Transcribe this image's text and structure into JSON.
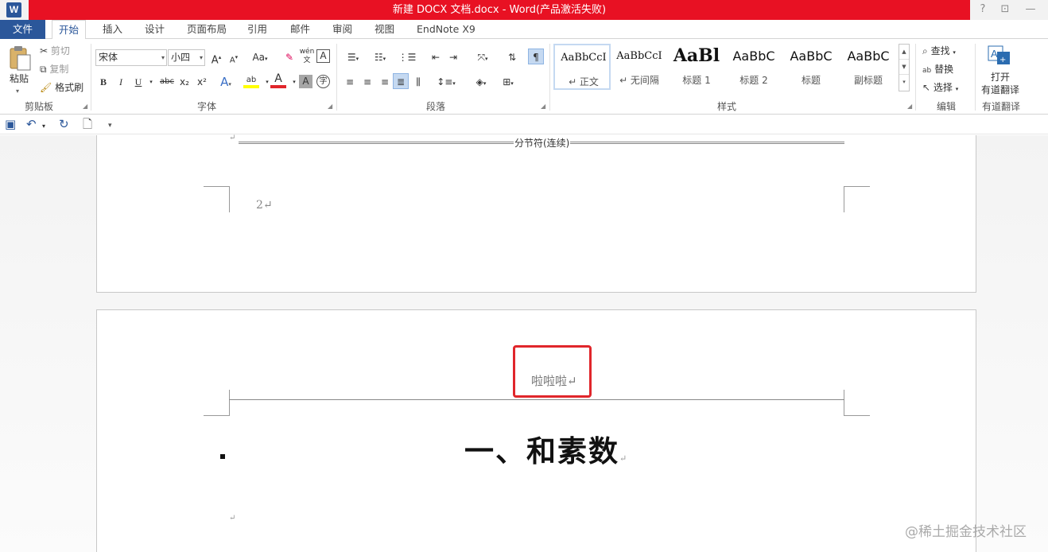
{
  "titlebar": {
    "app_icon": "W",
    "title": "新建 DOCX 文档.docx - Word(产品激活失败)",
    "help": "?",
    "restore": "⊡",
    "minimize": "—"
  },
  "tabs": {
    "file": "文件",
    "home": "开始",
    "insert": "插入",
    "design": "设计",
    "layout": "页面布局",
    "references": "引用",
    "mailings": "邮件",
    "review": "审阅",
    "view": "视图",
    "endnote": "EndNote X9"
  },
  "clipboard": {
    "paste": "粘贴",
    "cut": "剪切",
    "copy": "复制",
    "format_painter": "格式刷",
    "label": "剪贴板"
  },
  "font": {
    "name": "宋体",
    "size": "小四",
    "grow": "A",
    "shrink": "A",
    "case": "Aa",
    "bold": "B",
    "italic": "I",
    "underline": "U",
    "strike": "abc",
    "subscript": "x₂",
    "superscript": "x²",
    "effects": "A",
    "highlight": "ab",
    "color": "A",
    "shade": "A",
    "enclose": "字",
    "phonetic": "wén",
    "border": "A",
    "label": "字体"
  },
  "paragraph": {
    "label": "段落"
  },
  "styles": {
    "items": [
      {
        "sample": "AaBbCcI",
        "name": "↵ 正文"
      },
      {
        "sample": "AaBbCcI",
        "name": "↵ 无间隔"
      },
      {
        "sample": "AaBl",
        "name": "标题 1"
      },
      {
        "sample": "AaBbC",
        "name": "标题 2"
      },
      {
        "sample": "AaBbC",
        "name": "标题"
      },
      {
        "sample": "AaBbC",
        "name": "副标题"
      }
    ],
    "label": "样式"
  },
  "editing": {
    "find": "查找",
    "replace": "替换",
    "select": "选择",
    "label": "编辑"
  },
  "youdao": {
    "open_line1": "打开",
    "open_line2": "有道翻译",
    "label": "有道翻译"
  },
  "document": {
    "section_break": "分节符(连续)",
    "page_number": "2↵",
    "header_text": "啦啦啦↵",
    "heading": "一、和素数",
    "heading_mark": "↵",
    "para_mark": "↵"
  },
  "watermark": "@稀土掘金技术社区",
  "colors": {
    "title_red": "#e81123",
    "word_blue": "#2b579a",
    "highlight_box": "#e0262b"
  }
}
